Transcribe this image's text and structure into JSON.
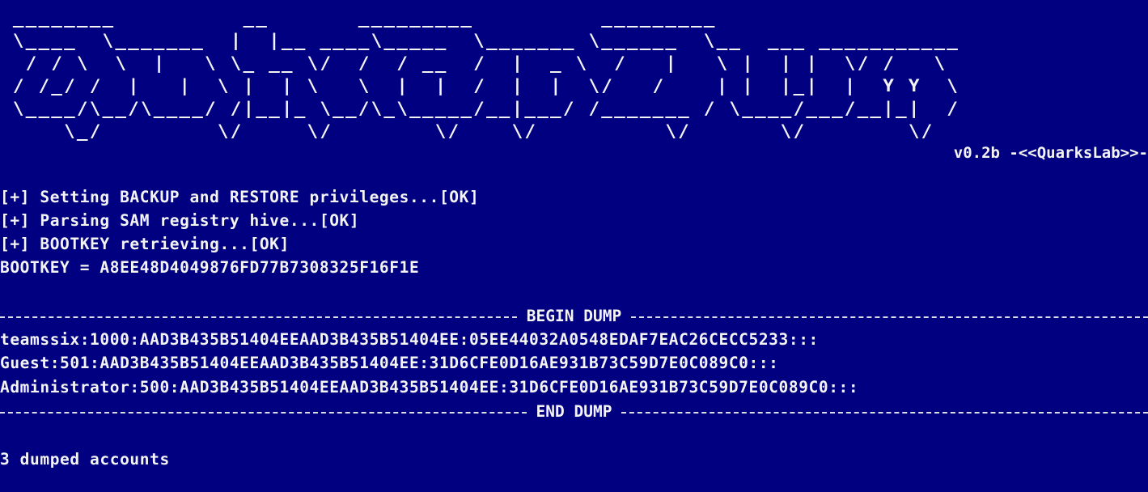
{
  "banner": {
    "version_tag": "v0.2b -<<QuarksLab>>-"
  },
  "status_lines": [
    "[+] Setting BACKUP and RESTORE privileges...[OK]",
    "[+] Parsing SAM registry hive...[OK]",
    "[+] BOOTKEY retrieving...[OK]",
    "BOOTKEY = A8EE48D4049876FD77B7308325F16F1E"
  ],
  "dump": {
    "begin_label": "BEGIN DUMP",
    "end_label": "END DUMP",
    "entries": [
      "teamssix:1000:AAD3B435B51404EEAAD3B435B51404EE:05EE44032A0548EDAF7EAC26CECC5233:::",
      "Guest:501:AAD3B435B51404EEAAD3B435B51404EE:31D6CFE0D16AE931B73C59D7E0C089C0:::",
      "Administrator:500:AAD3B435B51404EEAAD3B435B51404EE:31D6CFE0D16AE931B73C59D7E0C089C0:::"
    ]
  },
  "summary": "3 dumped accounts",
  "colors": {
    "background": "#000080",
    "text": "#f4f4f4"
  }
}
